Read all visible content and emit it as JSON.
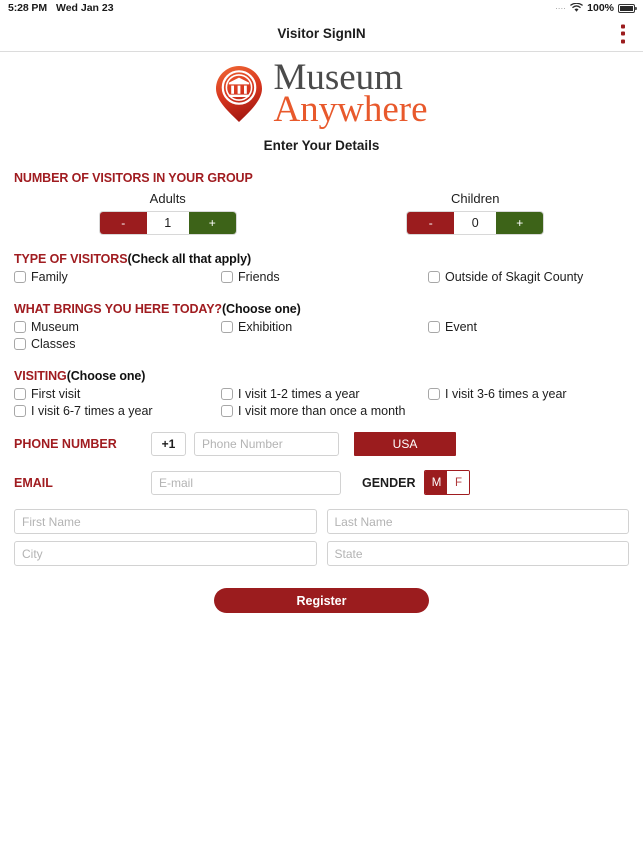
{
  "statusbar": {
    "time": "5:28 PM",
    "date": "Wed Jan 23",
    "signal_dots": "....",
    "wifi_icon": "wifi-icon",
    "battery_percent": "100%",
    "battery_icon": "battery-full-icon"
  },
  "titlebar": {
    "title": "Visitor SignIN",
    "overflow_icon": "overflow-menu-icon"
  },
  "logo": {
    "mark_icon": "museum-pin-icon",
    "line1": "Museum",
    "line2": "Anywhere",
    "line1_color": "#4b4b4b",
    "line2_color": "#e8592c"
  },
  "page": {
    "subtitle": "Enter Your Details"
  },
  "group": {
    "heading": "NUMBER OF VISITORS IN YOUR GROUP",
    "adults": {
      "label": "Adults",
      "minus": "-",
      "value": "1",
      "plus": "+"
    },
    "children": {
      "label": "Children",
      "minus": "-",
      "value": "0",
      "plus": "+"
    }
  },
  "type_of_visitors": {
    "heading": "TYPE OF VISITORS",
    "hint": "(Check all that apply)",
    "options": [
      {
        "label": "Family",
        "checked": false
      },
      {
        "label": "Friends",
        "checked": false
      },
      {
        "label": "Outside of Skagit County",
        "checked": false
      }
    ]
  },
  "brings_you_here": {
    "heading": "WHAT BRINGS YOU HERE TODAY?",
    "hint": "(Choose one)",
    "options": [
      {
        "label": "Museum",
        "checked": false
      },
      {
        "label": "Exhibition",
        "checked": false
      },
      {
        "label": "Event",
        "checked": false
      },
      {
        "label": "Classes",
        "checked": false
      }
    ]
  },
  "visiting": {
    "heading": "VISITING",
    "hint": "(Choose one)",
    "options": [
      {
        "label": "First visit",
        "checked": false
      },
      {
        "label": "I visit 1-2 times a year",
        "checked": false
      },
      {
        "label": "I visit 3-6 times a year",
        "checked": false
      },
      {
        "label": "I visit 6-7 times a year",
        "checked": false
      },
      {
        "label": "I visit more than once a month",
        "checked": false
      }
    ]
  },
  "phone": {
    "label": "PHONE NUMBER",
    "country_code_value": "+1",
    "number_placeholder": "Phone Number",
    "number_value": "",
    "country_button": "USA"
  },
  "email": {
    "label": "EMAIL",
    "placeholder": "E-mail",
    "value": ""
  },
  "gender": {
    "label": "GENDER",
    "male": "M",
    "female": "F",
    "selected": "M"
  },
  "name_fields": {
    "first_name_placeholder": "First Name",
    "first_name_value": "",
    "last_name_placeholder": "Last Name",
    "last_name_value": "",
    "city_placeholder": "City",
    "city_value": "",
    "state_placeholder": "State",
    "state_value": ""
  },
  "actions": {
    "register": "Register"
  },
  "colors": {
    "brand_red": "#9b1c1e",
    "heading_red": "#a01c20",
    "green": "#3d6318",
    "orange": "#e8592c",
    "gray_text": "#4b4b4b"
  }
}
